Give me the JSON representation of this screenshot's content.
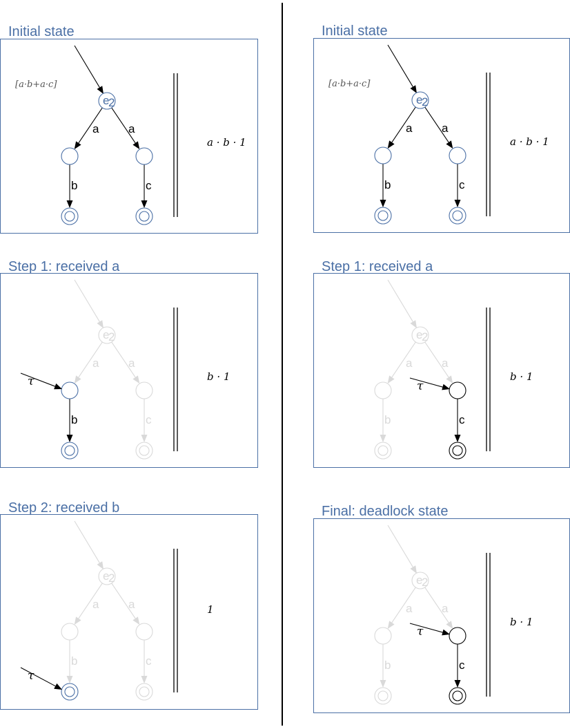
{
  "colors": {
    "title": "#4a6fa5",
    "active": "#4a6fa5",
    "current": "#000000",
    "faded": "#d9d9d9",
    "edge": "#000000"
  },
  "panels": [
    {
      "title": "Initial state",
      "expression": "[a·b+a·c]",
      "start_state": "e2",
      "edge_labels": [
        "a",
        "a",
        "b",
        "c"
      ],
      "formula": "a · b · 1",
      "tau_label": "",
      "mode": "initial-left"
    },
    {
      "title": "Initial state",
      "expression": "[a·b+a·c]",
      "start_state": "e2",
      "edge_labels": [
        "a",
        "a",
        "b",
        "c"
      ],
      "formula": "a · b · 1",
      "tau_label": "",
      "mode": "initial-right"
    },
    {
      "title": "Step 1: received a",
      "expression": "",
      "start_state": "e2",
      "edge_labels": [
        "a",
        "a",
        "b",
        "c"
      ],
      "formula": "b · 1",
      "tau_label": "τ",
      "mode": "step1-left"
    },
    {
      "title": "Step 1: received a",
      "expression": "",
      "start_state": "e2",
      "edge_labels": [
        "a",
        "a",
        "b",
        "c"
      ],
      "formula": "b · 1",
      "tau_label": "τ",
      "mode": "step1-right"
    },
    {
      "title": "Step 2: received b",
      "expression": "",
      "start_state": "e2",
      "edge_labels": [
        "a",
        "a",
        "b",
        "c"
      ],
      "formula": "1",
      "tau_label": "τ",
      "mode": "step2-left"
    },
    {
      "title": "Final: deadlock state",
      "expression": "",
      "start_state": "e2",
      "edge_labels": [
        "a",
        "a",
        "b",
        "c"
      ],
      "formula": "b · 1",
      "tau_label": "τ",
      "mode": "final-right"
    }
  ]
}
